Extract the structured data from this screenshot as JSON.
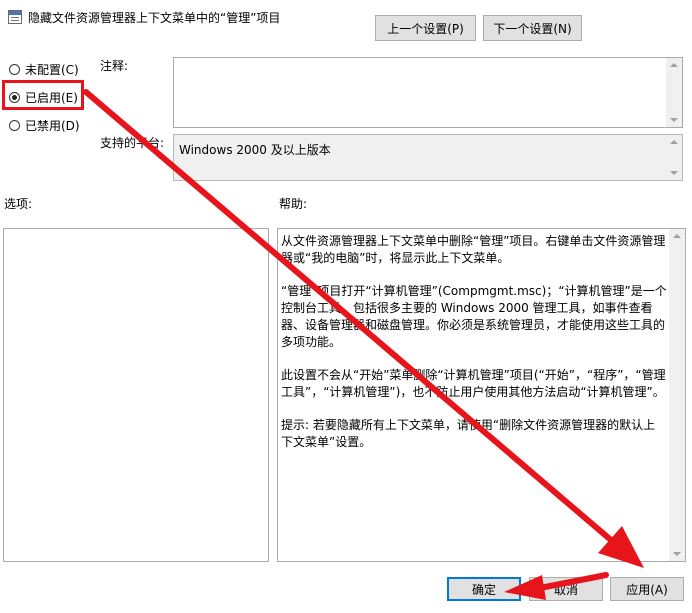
{
  "window": {
    "title": "隐藏文件资源管理器上下文菜单中的“管理”项目"
  },
  "nav": {
    "prev_label": "上一个设置(P)",
    "next_label": "下一个设置(N)"
  },
  "state": {
    "options": [
      {
        "label": "未配置(C)",
        "checked": false
      },
      {
        "label": "已启用(E)",
        "checked": true
      },
      {
        "label": "已禁用(D)",
        "checked": false
      }
    ]
  },
  "comment": {
    "label": "注释:",
    "value": ""
  },
  "platform": {
    "label": "支持的平台:",
    "value": "Windows 2000 及以上版本"
  },
  "options_pane": {
    "label": "选项:"
  },
  "help_pane": {
    "label": "帮助:",
    "paragraphs": [
      "从文件资源管理器上下文菜单中删除“管理”项目。右键单击文件资源管理器或“我的电脑”时，将显示此上下文菜单。",
      "“管理”项目打开“计算机管理”(Compmgmt.msc)；“计算机管理”是一个控制台工具，包括很多主要的 Windows 2000 管理工具，如事件查看器、设备管理器和磁盘管理。你必须是系统管理员，才能使用这些工具的多项功能。",
      "此设置不会从“开始”菜单删除“计算机管理”项目(“开始”，“程序”，“管理工具”，“计算机管理”)，也不防止用户使用其他方法启动“计算机管理”。",
      "提示: 若要隐藏所有上下文菜单，请使用“删除文件资源管理器的默认上下文菜单”设置。"
    ]
  },
  "footer": {
    "ok_label": "确定",
    "cancel_label": "取消",
    "apply_label": "应用(A)"
  },
  "colors": {
    "annotation_red": "#e8141b",
    "focus_blue": "#0078d7"
  }
}
